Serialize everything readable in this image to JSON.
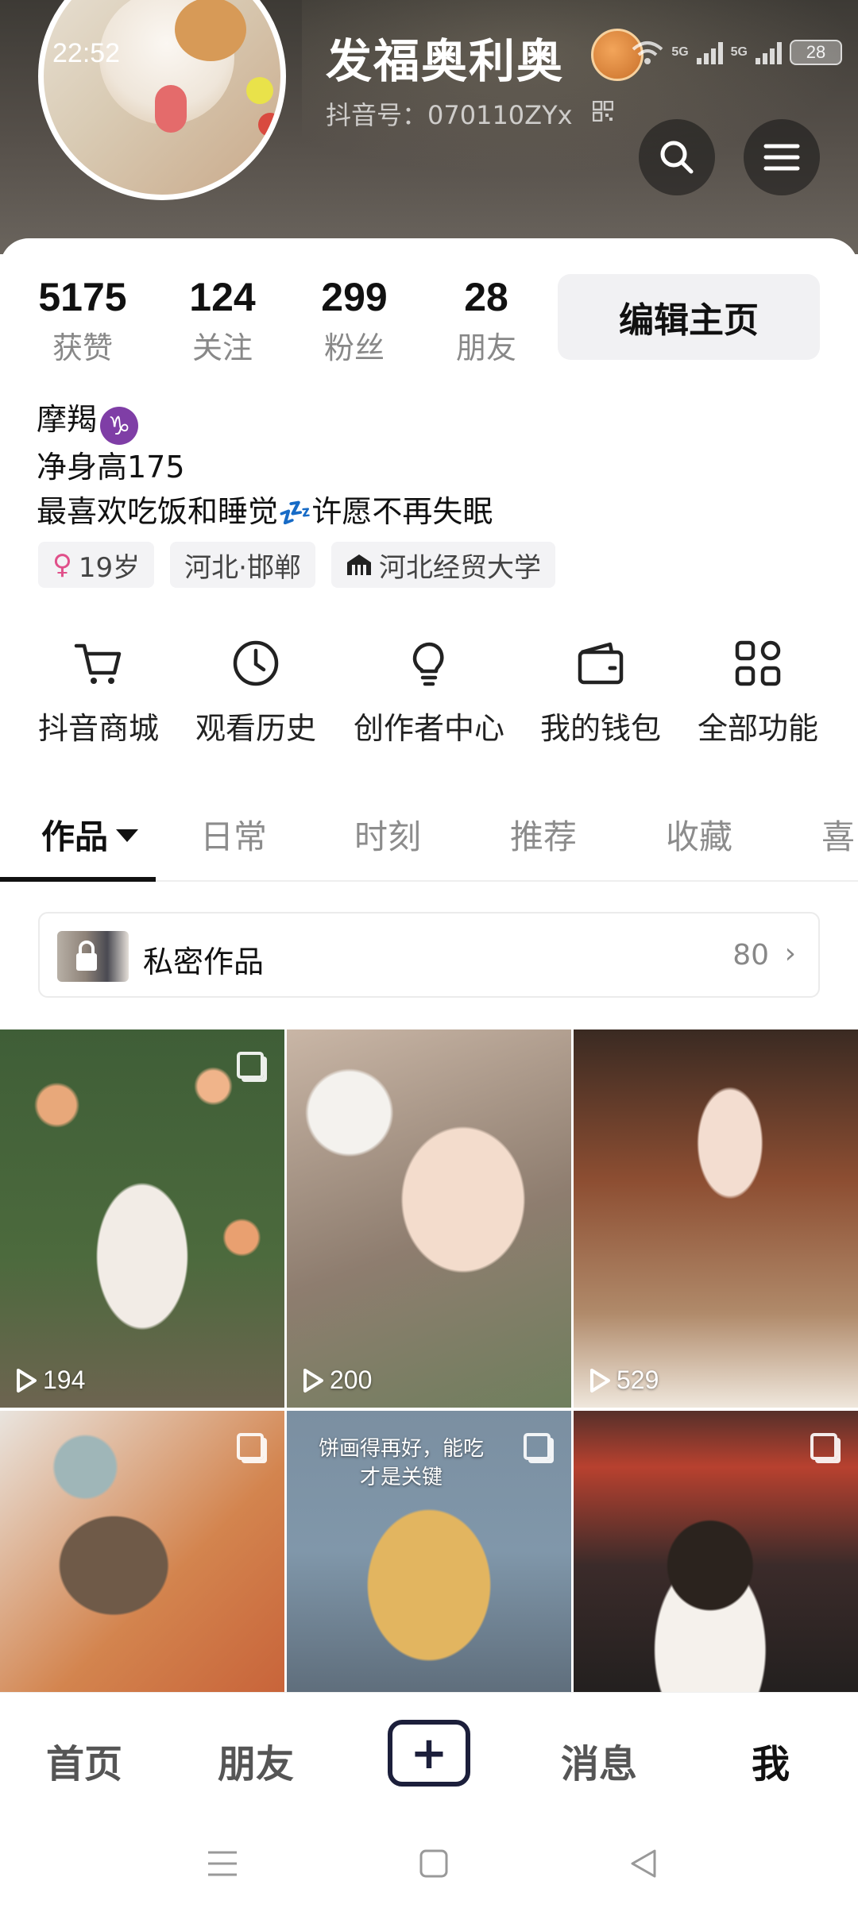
{
  "status_bar": {
    "time": "22:52",
    "network_1": "5G",
    "network_2": "5G",
    "battery": "28"
  },
  "profile": {
    "nickname": "发福奥利奥",
    "douyin_id": "抖音号：070110ZYx",
    "stats": [
      {
        "value": "5175",
        "label": "获赞"
      },
      {
        "value": "124",
        "label": "关注"
      },
      {
        "value": "299",
        "label": "粉丝"
      },
      {
        "value": "28",
        "label": "朋友"
      }
    ],
    "edit_button": "编辑主页",
    "bio_line1": "摩羯",
    "zodiac_symbol": "♑",
    "bio_line2": "净身高175",
    "bio_line3_a": "最喜欢吃饭和睡觉",
    "bio_zzz": "💤",
    "bio_line3_b": "许愿不再失眠",
    "tags": [
      {
        "icon": "female-icon",
        "symbol": "♀",
        "text": "19岁"
      },
      {
        "icon": "",
        "symbol": "",
        "text": "河北·邯郸"
      },
      {
        "icon": "school-icon",
        "symbol": "",
        "text": "河北经贸大学"
      }
    ]
  },
  "features": [
    {
      "icon": "cart-icon",
      "label": "抖音商城"
    },
    {
      "icon": "clock-icon",
      "label": "观看历史"
    },
    {
      "icon": "bulb-icon",
      "label": "创作者中心"
    },
    {
      "icon": "wallet-icon",
      "label": "我的钱包"
    },
    {
      "icon": "grid-icon",
      "label": "全部功能"
    }
  ],
  "content_tabs": [
    "作品",
    "日常",
    "时刻",
    "推荐",
    "收藏",
    "喜"
  ],
  "private_works": {
    "label": "私密作品",
    "count": "80",
    "chevron": "›"
  },
  "videos": [
    {
      "plays": "194",
      "multi": true,
      "caption": ""
    },
    {
      "plays": "200",
      "multi": false,
      "caption": ""
    },
    {
      "plays": "529",
      "multi": false,
      "caption": ""
    },
    {
      "plays": "",
      "multi": true,
      "caption": ""
    },
    {
      "plays": "",
      "multi": true,
      "caption_line1": "饼画得再好，能吃",
      "caption_line2": "才是关键"
    },
    {
      "plays": "",
      "multi": true,
      "caption": ""
    }
  ],
  "bottom_nav": {
    "home": "首页",
    "friends": "朋友",
    "plus": "+",
    "messages": "消息",
    "me": "我"
  },
  "colors": {
    "header": "#56504a",
    "text_primary": "#111111",
    "text_secondary": "#888888",
    "tag_bg": "#f3f3f5",
    "plus_border": "#1c1f3b"
  }
}
